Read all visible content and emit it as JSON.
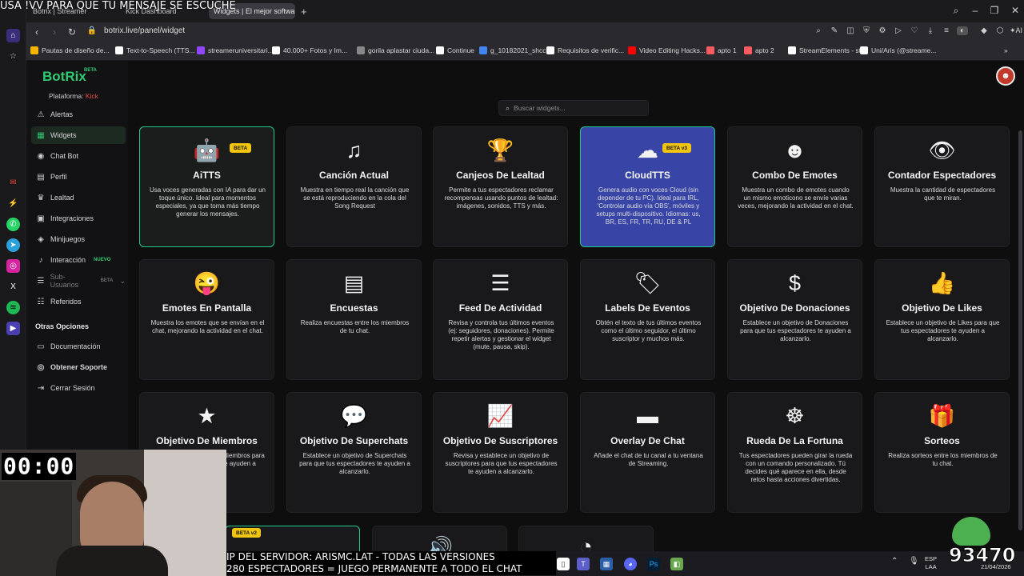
{
  "overlay_top": "USA !VV PARA QUE TU MENSAJE SE ESCUCHE",
  "tabs": [
    {
      "label": "Botrix | Streamer",
      "active": false
    },
    {
      "label": "Kick Dashboard",
      "active": false
    },
    {
      "label": "Widgets | El mejor softwa",
      "active": true
    }
  ],
  "url": "botrix.live/panel/widget",
  "bookmarks": [
    {
      "label": "Pautas de diseño de...",
      "color": "#f4b400"
    },
    {
      "label": "Text-to-Speech (TTS...",
      "color": "#ffffff"
    },
    {
      "label": "streameruniversitari...",
      "color": "#9146ff"
    },
    {
      "label": "40.000+ Fotos y Im...",
      "color": "#ffffff"
    },
    {
      "label": "gorila aplastar ciuda...",
      "color": "#888888"
    },
    {
      "label": "Continue",
      "color": "#ffffff"
    },
    {
      "label": "g_10182021_shcc",
      "color": "#4285f4"
    },
    {
      "label": "Requisitos de verific...",
      "color": "#ffffff"
    },
    {
      "label": "Video Editing Hacks...",
      "color": "#ff0000"
    },
    {
      "label": "apto 1",
      "color": "#ff5a5f"
    },
    {
      "label": "apto 2",
      "color": "#ff5a5f"
    },
    {
      "label": "StreamElements - st...",
      "color": "#ffffff"
    },
    {
      "label": "Uni/Aris (@streame...",
      "color": "#ffffff"
    }
  ],
  "app": {
    "logo": "BotRix",
    "logo_beta": "BETA",
    "platform_label": "Plataforma:",
    "platform_value": "Kick",
    "nav": [
      {
        "label": "Alertas",
        "icon": "warning-icon",
        "glyph": "⚠"
      },
      {
        "label": "Widgets",
        "icon": "widgets-icon",
        "glyph": "▦",
        "active": true
      },
      {
        "label": "Chat Bot",
        "icon": "robot-icon",
        "glyph": "◉"
      },
      {
        "label": "Perfil",
        "icon": "profile-icon",
        "glyph": "▤"
      },
      {
        "label": "Lealtad",
        "icon": "trophy-icon",
        "glyph": "♛"
      },
      {
        "label": "Integraciones",
        "icon": "integrations-icon",
        "glyph": "▣"
      },
      {
        "label": "Minijuegos",
        "icon": "gamepad-icon",
        "glyph": "◈"
      },
      {
        "label": "Interacción",
        "icon": "music-icon",
        "glyph": "♪",
        "badge": "NUEVO"
      },
      {
        "label": "Sub-Usuarios",
        "icon": "users-icon",
        "glyph": "☰",
        "badge": "BETA",
        "dim": true
      },
      {
        "label": "Referidos",
        "icon": "referrals-icon",
        "glyph": "☷"
      }
    ],
    "other_title": "Otras Opciones",
    "other": [
      {
        "label": "Documentación",
        "icon": "docs-icon",
        "glyph": "▭"
      },
      {
        "label": "Obtener Soporte",
        "icon": "support-icon",
        "glyph": "◎",
        "bold": true
      },
      {
        "label": "Cerrar Sesión",
        "icon": "logout-icon",
        "glyph": "⇥"
      }
    ],
    "search_placeholder": "Buscar widgets...",
    "widgets": [
      {
        "title": "AiTTS",
        "icon": "robot-icon",
        "glyph": "🤖",
        "badge": "BETA",
        "style": "hl-green",
        "desc": "Usa voces generadas con IA para dar un toque único. Ideal para momentos especiales, ya que toma más tiempo generar los mensajes."
      },
      {
        "title": "Canción Actual",
        "icon": "music-icon",
        "glyph": "♫",
        "desc": "Muestra en tiempo real la canción que se está reproduciendo en la cola del Song Request"
      },
      {
        "title": "Canjeos De Lealtad",
        "icon": "trophy-icon",
        "glyph": "🏆",
        "desc": "Permite a tus espectadores reclamar recompensas usando puntos de lealtad: imágenes, sonidos, TTS y más."
      },
      {
        "title": "CloudTTS",
        "icon": "cloud-icon",
        "glyph": "☁",
        "badge": "BETA v3",
        "style": "hl-blue",
        "desc": "Genera audio con voces Cloud (sin depender de tu PC). Ideal para IRL, 'Controlar audio vía OBS', móviles y setups multi-dispositivo. Idiomas: us, BR, ES, FR, TR, RU, DE & PL"
      },
      {
        "title": "Combo De Emotes",
        "icon": "emote-icon",
        "glyph": "☻",
        "desc": "Muestra un combo de emotes cuando un mismo emoticono se envíe varias veces, mejorando la actividad en el chat."
      },
      {
        "title": "Contador Espectadores",
        "icon": "eye-icon",
        "glyph": "👁",
        "desc": "Muestra la cantidad de espectadores que te miran."
      },
      {
        "title": "Emotes En Pantalla",
        "icon": "tongue-face-icon",
        "glyph": "😜",
        "desc": "Muestra los emotes que se envían en el chat, mejorando la actividad en el chat."
      },
      {
        "title": "Encuestas",
        "icon": "poll-icon",
        "glyph": "▤",
        "desc": "Realiza encuestas entre los miembros de tu chat."
      },
      {
        "title": "Feed De Actividad",
        "icon": "list-icon",
        "glyph": "☰",
        "desc": "Revisa y controla tus últimos eventos (ej: seguidores, donaciones). Permite repetir alertas y gestionar el widget (mute, pausa, skip)."
      },
      {
        "title": "Labels De Eventos",
        "icon": "tags-icon",
        "glyph": "🏷",
        "desc": "Obtén el texto de tus últimos eventos como el último seguidor, el último suscriptor y muchos más."
      },
      {
        "title": "Objetivo De Donaciones",
        "icon": "dollar-icon",
        "glyph": "$",
        "desc": "Establece un objetivo de Donaciones para que tus espectadores te ayuden a alcanzarlo."
      },
      {
        "title": "Objetivo De Likes",
        "icon": "thumbs-up-icon",
        "glyph": "👍",
        "desc": "Establece un objetivo de Likes para que tus espectadores te ayuden a alcanzarlo."
      },
      {
        "title": "Objetivo De Miembros",
        "icon": "star-icon",
        "glyph": "★",
        "desc": "Establece un objetivo de Miembros para que tus espectadores te ayuden a alcanzarlo."
      },
      {
        "title": "Objetivo De Superchats",
        "icon": "dollar-chat-icon",
        "glyph": "💬",
        "desc": "Establece un objetivo de Superchats para que tus espectadores te ayuden a alcanzarlo."
      },
      {
        "title": "Objetivo De Suscriptores",
        "icon": "chart-line-icon",
        "glyph": "📈",
        "desc": "Revisa y establece un objetivo de suscriptores para que tus espectadores te ayuden a alcanzarlo."
      },
      {
        "title": "Overlay De Chat",
        "icon": "chat-bubble-icon",
        "glyph": "▬",
        "desc": "Añade el chat de tu canal a tu ventana de Streaming."
      },
      {
        "title": "Rueda De La Fortuna",
        "icon": "wheel-icon",
        "glyph": "☸",
        "desc": "Tus espectadores pueden girar la rueda con un comando personalizado. Tú decides qué aparece en ella, desde retos hasta acciones divertidas."
      },
      {
        "title": "Sorteos",
        "icon": "gift-icon",
        "glyph": "🎁",
        "desc": "Realiza sorteos entre los miembros de tu chat."
      }
    ],
    "partial_badge": "BETA v2"
  },
  "stream": {
    "timer": "00:00",
    "ticker_line1": "IP DEL SERVIDOR: ARISMC.LAT - TODAS LAS VERSIONES",
    "ticker_line2": "280 ESPECTADORES = JUEGO PERMANENTE A TODO EL CHAT",
    "counter": "93470"
  },
  "system": {
    "lang": "ESP",
    "lang2": "LAA",
    "time": "",
    "date": "21/04/2026"
  }
}
